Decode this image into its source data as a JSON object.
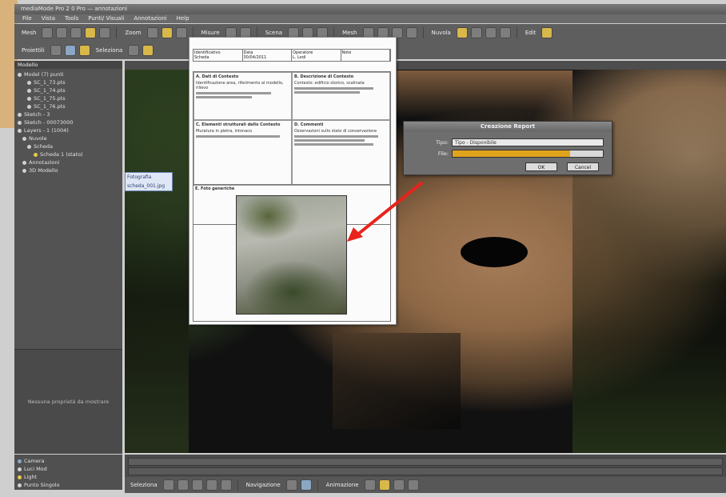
{
  "window": {
    "title": "mediaMode Pro 2 0 Pro — annotazioni"
  },
  "menu": [
    "File",
    "Vista",
    "Tools",
    "Punti/ Visuali",
    "Annotazioni",
    "Help"
  ],
  "toolbar": {
    "labels": [
      "Mesh",
      "Zoom",
      "Misure",
      "Scena",
      "Mesh",
      "Nuvola",
      "Edit"
    ]
  },
  "toolbar2": {
    "labels": [
      "Proiettili",
      "Seleziona"
    ]
  },
  "left_panel": {
    "header": "Modello",
    "tree": [
      {
        "label": "Model (7) punti",
        "icon": "node-icon"
      },
      {
        "label": "SC_1_73.pts",
        "icon": "file-icon"
      },
      {
        "label": "SC_1_74.pts",
        "icon": "file-icon"
      },
      {
        "label": "SC_1_75.pts",
        "icon": "file-icon"
      },
      {
        "label": "SC_1_76.pts",
        "icon": "file-icon"
      },
      {
        "label": "Sketch - 3",
        "icon": "node-icon"
      },
      {
        "label": "Sketch - 00073000",
        "icon": "node-icon"
      },
      {
        "label": "Layers - 1 (1004)",
        "icon": "node-icon"
      },
      {
        "label": "Nuvole",
        "icon": "node-icon"
      },
      {
        "label": "Scheda",
        "icon": "node-icon"
      },
      {
        "label": "Scheda 1 (stato)",
        "icon": "scheda-icon"
      },
      {
        "label": "Annotazioni",
        "icon": "node-icon"
      },
      {
        "label": "3D Modello",
        "icon": "node-icon"
      }
    ],
    "properties_empty": "Nessuna proprietà da mostrare",
    "lower_items": [
      "Camera",
      "Luci Mod",
      "Light",
      "Punto Singolo"
    ]
  },
  "tooltip": {
    "line1": "Fotografia",
    "line2": "scheda_001.jpg"
  },
  "report": {
    "header": [
      "Identificativo",
      "Data",
      "Operatore",
      "Note"
    ],
    "header_values": [
      "Scheda",
      "30/04/2011",
      "L. Lodi"
    ],
    "sections": [
      {
        "title": "A. Dati di Contesto",
        "body": "Identificazione area, riferimento al modello, rilievo"
      },
      {
        "title": "B. Descrizione di Contesto",
        "body": "Contesto: edificio storico, scalinata"
      },
      {
        "title": "C. Elementi strutturali dello Contesto",
        "body": "Muratura in pietra, intonaco"
      },
      {
        "title": "D. Commenti",
        "body": "Osservazioni sullo stato di conservazione"
      }
    ],
    "photo_section": "E. Foto generiche"
  },
  "dialog": {
    "title": "Creazione Report",
    "tipo_label": "Tipo:",
    "tipo_value": "Tipo - Disponibile",
    "file_label": "File:",
    "progress": 0.78,
    "ok_label": "OK",
    "cancel_label": "Cancel"
  },
  "timeline": {
    "bottom_labels": [
      "Seleziona",
      "Navigazione",
      "Animazione"
    ]
  },
  "colors": {
    "accent": "#e0a41c",
    "arrow": "#e8231b"
  }
}
